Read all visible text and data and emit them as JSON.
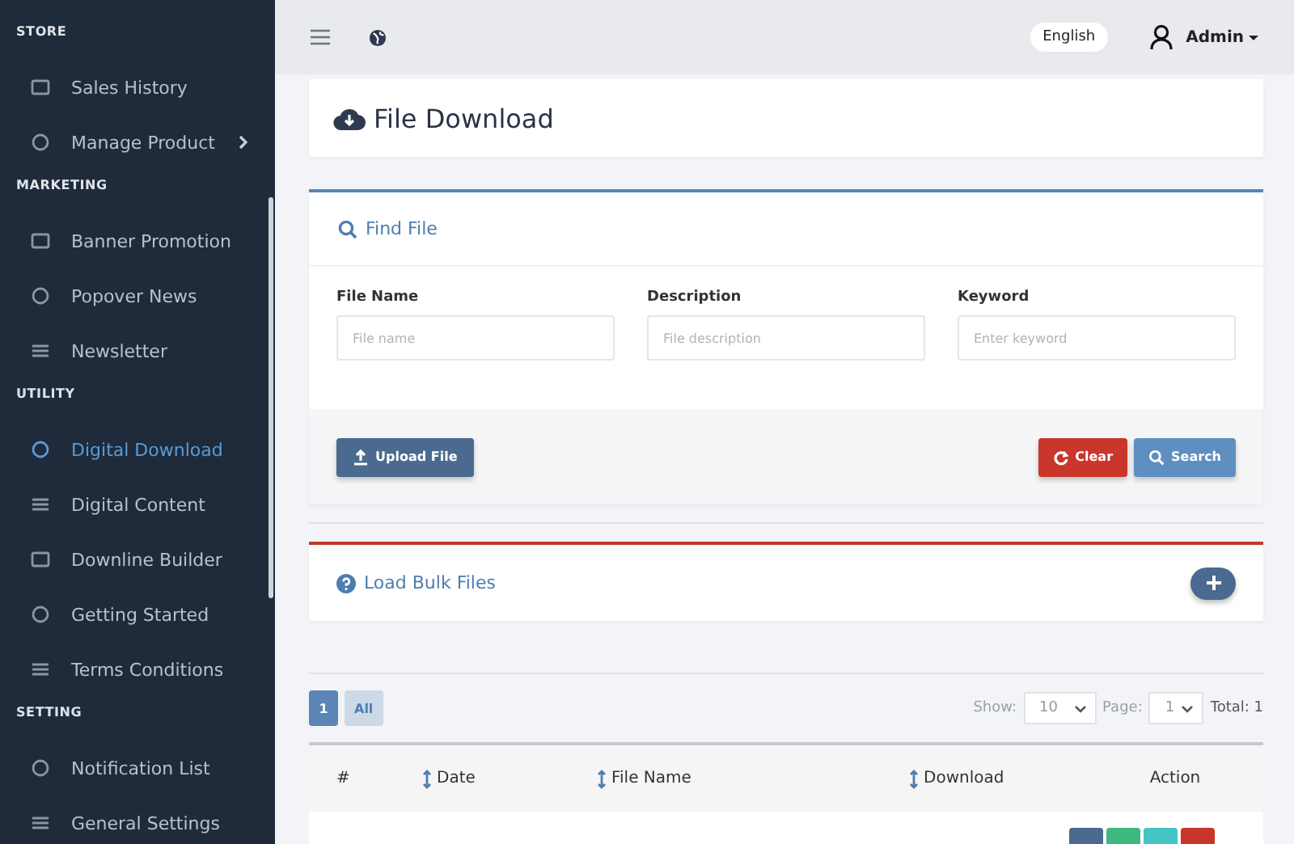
{
  "sidebar": {
    "items": [
      {
        "kind": "section",
        "label": "STORE"
      },
      {
        "kind": "item",
        "label": "Sales History",
        "selected": false
      },
      {
        "kind": "item",
        "label": "Manage Product",
        "selected": false,
        "has_submenu": true
      },
      {
        "kind": "section",
        "label": "MARKETING"
      },
      {
        "kind": "item",
        "label": "Banner Promotion",
        "selected": false
      },
      {
        "kind": "item",
        "label": "Popover News",
        "selected": false
      },
      {
        "kind": "item",
        "label": "Newsletter",
        "selected": false
      },
      {
        "kind": "section",
        "label": "UTILITY"
      },
      {
        "kind": "item",
        "label": "Digital Download",
        "selected": true
      },
      {
        "kind": "item",
        "label": "Digital Content",
        "selected": false
      },
      {
        "kind": "item",
        "label": "Downline Builder",
        "selected": false
      },
      {
        "kind": "item",
        "label": "Getting Started",
        "selected": false
      },
      {
        "kind": "item",
        "label": "Terms Conditions",
        "selected": false
      },
      {
        "kind": "section",
        "label": "SETTING"
      },
      {
        "kind": "item",
        "label": "Notification List",
        "selected": false
      },
      {
        "kind": "item",
        "label": "General Settings",
        "selected": false
      }
    ]
  },
  "topbar": {
    "language": "English",
    "user": "Admin"
  },
  "page_title": "File Download",
  "find_file": {
    "title": "Find File",
    "fields": [
      {
        "label": "File Name",
        "placeholder": "File name"
      },
      {
        "label": "Description",
        "placeholder": "File description"
      },
      {
        "label": "Keyword",
        "placeholder": "Enter keyword"
      }
    ],
    "upload_button": "Upload File",
    "clear_button": "Clear",
    "search_button": "Search"
  },
  "bulk": {
    "title": "Load Bulk Files"
  },
  "pagination": {
    "pages": [
      {
        "label": "1",
        "selected": true
      },
      {
        "label": "All",
        "selected": false
      }
    ],
    "show_label": "Show:",
    "show_value": "10",
    "page_label": "Page:",
    "page_value": "1",
    "total": "Total: 1"
  },
  "table": {
    "columns": [
      {
        "label": "#",
        "sortable": false
      },
      {
        "label": "Date",
        "sortable": true
      },
      {
        "label": "File Name",
        "sortable": true
      },
      {
        "label": "Download",
        "sortable": true
      },
      {
        "label": "Action",
        "sortable": false
      }
    ],
    "rows": [
      {
        "actions": [
          {
            "color": "#4a6a8f"
          },
          {
            "color": "#3fb87f"
          },
          {
            "color": "#45c4c4"
          },
          {
            "color": "#c8352b"
          }
        ]
      }
    ]
  }
}
